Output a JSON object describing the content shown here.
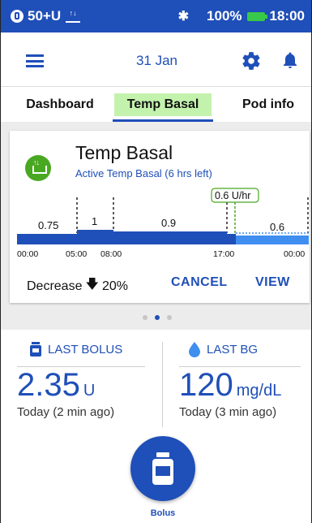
{
  "status_bar": {
    "pod_status": "50+U",
    "battery": "100%",
    "time": "18:00",
    "bluetooth_icon": "bluetooth-icon",
    "battery_color": "#38c84a"
  },
  "header": {
    "date": "31 Jan",
    "menu_icon": "hamburger-menu-icon",
    "settings_icon": "gear-icon",
    "notification_icon": "bell-icon"
  },
  "tabs": [
    {
      "label": "Dashboard",
      "active": false
    },
    {
      "label": "Temp Basal",
      "active": true
    },
    {
      "label": "Pod info",
      "active": false
    }
  ],
  "temp_basal_card": {
    "title": "Temp Basal",
    "subtitle": "Active Temp Basal (6 hrs left)",
    "current_rate_label": "0.6 U/hr",
    "segments": [
      {
        "start": "00:00",
        "end": "05:00",
        "rate": "0.75"
      },
      {
        "start": "05:00",
        "end": "08:00",
        "rate": "1"
      },
      {
        "start": "08:00",
        "end": "17:00",
        "rate": "0.9"
      },
      {
        "start": "17:00",
        "end": "00:00",
        "rate": "0.6"
      }
    ],
    "time_labels": [
      "00:00",
      "05:00",
      "08:00",
      "17:00",
      "00:00"
    ],
    "decrease_label": "Decrease",
    "decrease_value": "20%",
    "cancel_label": "CANCEL",
    "view_label": "VIEW",
    "colors": {
      "bar": "#1f4fb8",
      "bar_future": "#3f8ef0",
      "badge": "#49a821",
      "tab_active_bg": "#c3f2ad"
    }
  },
  "pager": {
    "count": 3,
    "active_index": 1
  },
  "last_bolus": {
    "label": "LAST BOLUS",
    "value": "2.35",
    "unit": "U",
    "ago": "Today (2 min ago)"
  },
  "last_bg": {
    "label": "LAST BG",
    "value": "120",
    "unit": "mg/dL",
    "ago": "Today (3 min ago)"
  },
  "bolus_button": {
    "label": "Bolus"
  }
}
